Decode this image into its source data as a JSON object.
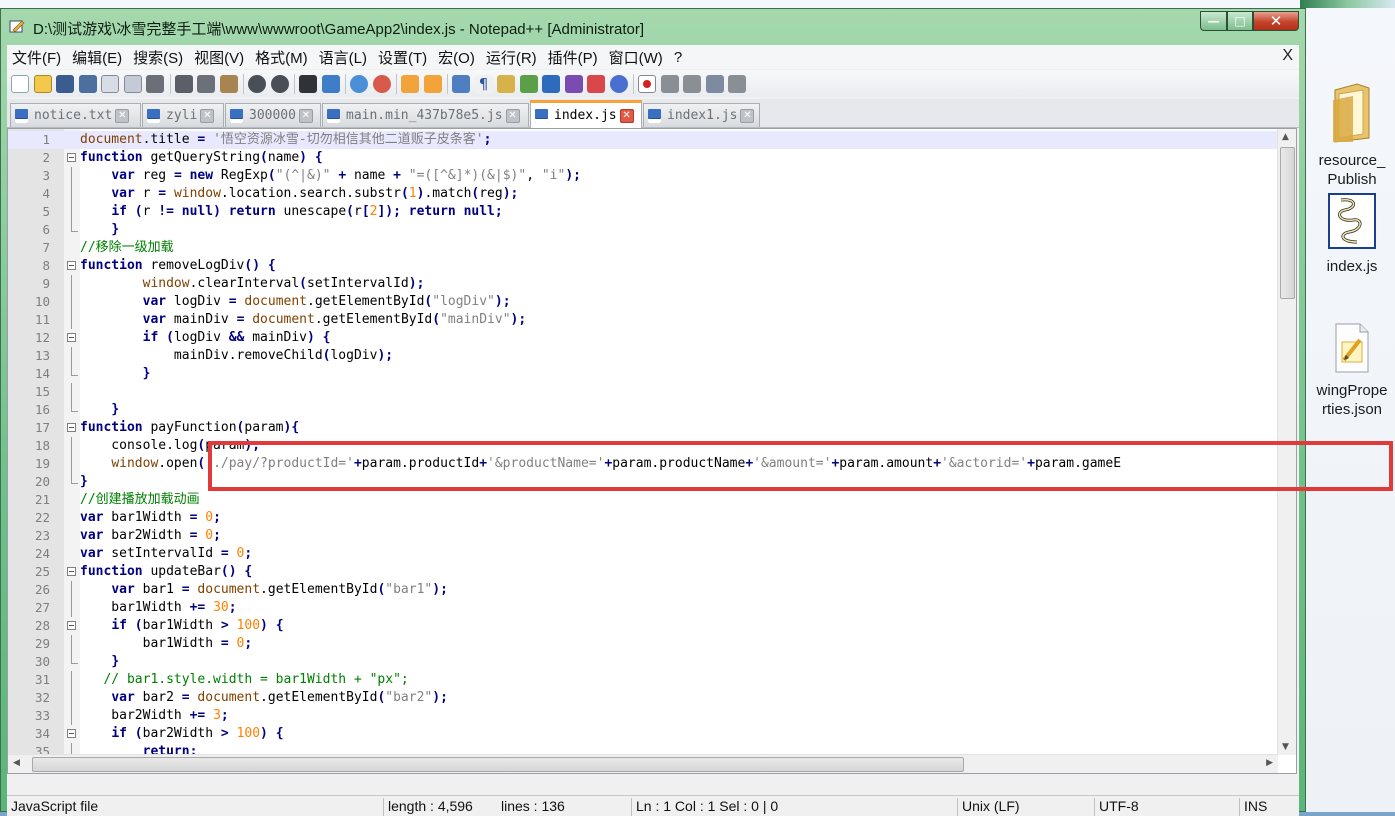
{
  "window": {
    "title": "D:\\测试游戏\\冰雪完整手工端\\www\\wwwroot\\GameApp2\\index.js - Notepad++ [Administrator]",
    "min_glyph": "—",
    "max_glyph": "□",
    "close_glyph": "✕"
  },
  "menu": {
    "items": [
      "文件(F)",
      "编辑(E)",
      "搜索(S)",
      "视图(V)",
      "格式(M)",
      "语言(L)",
      "设置(T)",
      "宏(O)",
      "运行(R)",
      "插件(P)",
      "窗口(W)",
      "?"
    ],
    "close": "X"
  },
  "tabs": [
    {
      "label": "notice.txt",
      "active": false
    },
    {
      "label": "zyli",
      "active": false
    },
    {
      "label": "300000",
      "active": false
    },
    {
      "label": "main.min_437b78e5.js",
      "active": false
    },
    {
      "label": "index.js",
      "active": true
    },
    {
      "label": "index1.js",
      "active": false
    }
  ],
  "editor": {
    "lines": [
      "document.title = '悟空资源冰雪-切勿相信其他二道贩子皮条客';",
      "function getQueryString(name) {",
      "    var reg = new RegExp(\"(^|&)\" + name + \"=([^&]*)(&|$)\", \"i\");",
      "    var r = window.location.search.substr(1).match(reg);",
      "    if (r != null) return unescape(r[2]); return null;",
      "    }",
      "//移除一级加载",
      "function removeLogDiv() {",
      "        window.clearInterval(setIntervalId);",
      "        var logDiv = document.getElementById(\"logDiv\");",
      "        var mainDiv = document.getElementById(\"mainDiv\");",
      "        if (logDiv && mainDiv) {",
      "            mainDiv.removeChild(logDiv);",
      "        }",
      "",
      "    }",
      "function payFunction(param){",
      "    console.log(param);",
      "    window.open('./pay/?productId='+param.productId+'&productName='+param.productName+'&amount='+param.amount+'&actorid='+param.gameE",
      "}",
      "//创建播放加载动画",
      "var bar1Width = 0;",
      "var bar2Width = 0;",
      "var setIntervalId = 0;",
      "function updateBar() {",
      "    var bar1 = document.getElementById(\"bar1\");",
      "    bar1Width += 30;",
      "    if (bar1Width > 100) {",
      "        bar1Width = 0;",
      "    }",
      "   // bar1.style.width = bar1Width + \"px\";",
      "    var bar2 = document.getElementById(\"bar2\");",
      "    bar2Width += 3;",
      "    if (bar2Width > 100) {",
      "        return;",
      "    }"
    ]
  },
  "status": {
    "file_type": "JavaScript file",
    "length": "length : 4,596",
    "lines": "lines : 136",
    "position": "Ln : 1    Col : 1    Sel : 0 | 0",
    "eol": "Unix (LF)",
    "encoding": "UTF-8",
    "mode": "INS"
  },
  "desktop": {
    "icons": [
      {
        "label1": "resource_",
        "label2": "Publish"
      },
      {
        "label1": "index.js",
        "label2": ""
      },
      {
        "label1": "wingPrope",
        "label2": "rties.json"
      }
    ]
  },
  "colors": {
    "keyword": "#0000ff",
    "string": "#808080",
    "number": "#ff8000",
    "comment": "#008000",
    "function": "#804000",
    "highlight_box": "#e03a3a",
    "active_tab_accent": "#f7a23a"
  }
}
